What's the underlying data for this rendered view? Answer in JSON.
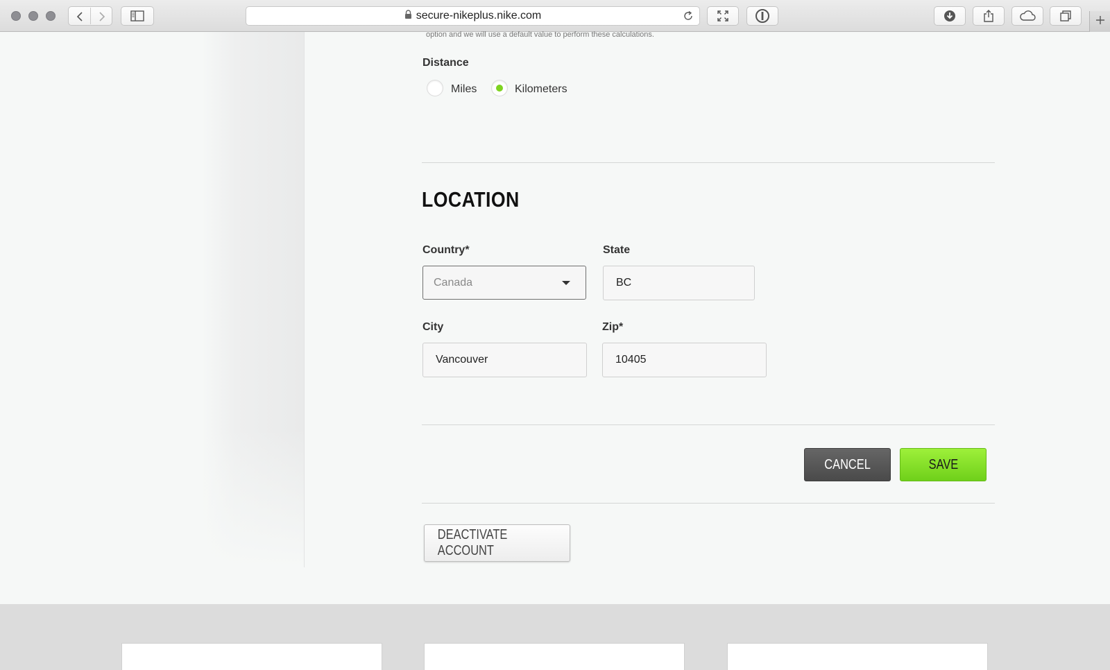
{
  "browser": {
    "url": "secure-nikeplus.nike.com"
  },
  "settings": {
    "note_text": "option and we will use a default value to perform these calculations.",
    "distance": {
      "label": "Distance",
      "options": [
        {
          "label": "Miles",
          "selected": false
        },
        {
          "label": "Kilometers",
          "selected": true
        }
      ]
    }
  },
  "location": {
    "title": "LOCATION",
    "country": {
      "label": "Country*",
      "value": "Canada"
    },
    "state": {
      "label": "State",
      "value": "BC"
    },
    "city": {
      "label": "City",
      "value": "Vancouver"
    },
    "zip": {
      "label": "Zip*",
      "value": "10405"
    }
  },
  "actions": {
    "cancel_label": "CANCEL",
    "save_label": "SAVE",
    "deactivate_label": "DEACTIVATE ACCOUNT"
  },
  "colors": {
    "accent_green": "#7ed321",
    "cancel_gray": "#555555"
  }
}
